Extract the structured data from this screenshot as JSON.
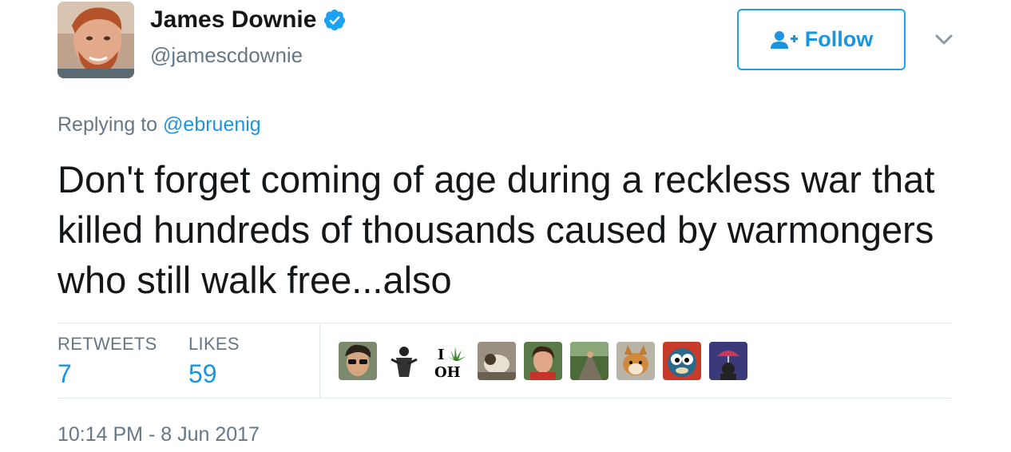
{
  "author": {
    "display_name": "James Downie",
    "handle": "@jamescdownie",
    "verified": true
  },
  "follow_button": {
    "label": "Follow"
  },
  "reply": {
    "prefix": "Replying to",
    "mention": "@ebruenig"
  },
  "tweet": {
    "text": "Don't forget coming of age during a reckless war that killed hundreds of thousands caused by warmongers who still walk free...also"
  },
  "stats": {
    "retweets_label": "RETWEETS",
    "retweets_value": "7",
    "likes_label": "LIKES",
    "likes_value": "59"
  },
  "timestamp": "10:14 PM - 8 Jun 2017",
  "colors": {
    "accent": "#1da1f2",
    "link": "#1b95e0",
    "muted": "#657786",
    "text": "#14171a"
  },
  "icons": [
    "verified-badge-icon",
    "follow-person-icon",
    "chevron-down-icon"
  ],
  "likers": [
    {
      "name": "liker-avatar-1"
    },
    {
      "name": "liker-avatar-2"
    },
    {
      "name": "liker-avatar-3"
    },
    {
      "name": "liker-avatar-4"
    },
    {
      "name": "liker-avatar-5"
    },
    {
      "name": "liker-avatar-6"
    },
    {
      "name": "liker-avatar-7"
    },
    {
      "name": "liker-avatar-8"
    },
    {
      "name": "liker-avatar-9"
    }
  ]
}
